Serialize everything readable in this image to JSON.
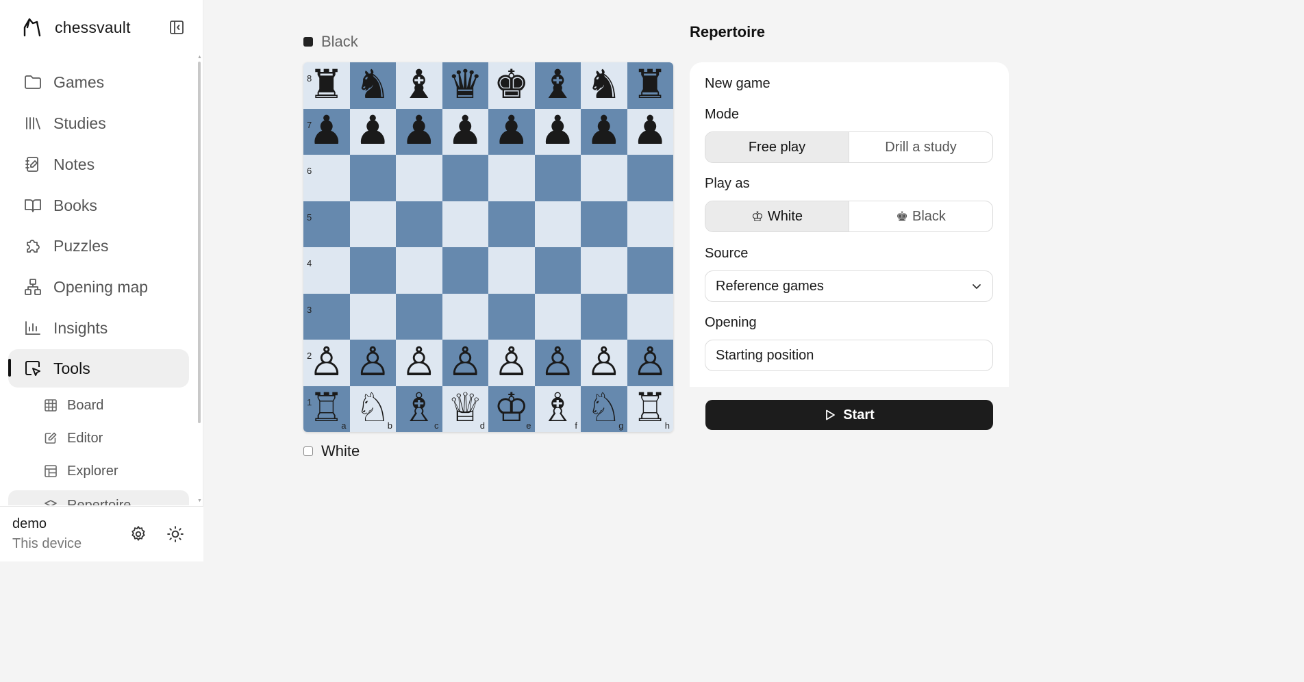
{
  "app": {
    "name": "chessvault"
  },
  "sidebar": {
    "items": [
      {
        "label": "Games",
        "icon": "folder-icon"
      },
      {
        "label": "Studies",
        "icon": "library-icon"
      },
      {
        "label": "Notes",
        "icon": "notebook-icon"
      },
      {
        "label": "Books",
        "icon": "book-icon"
      },
      {
        "label": "Puzzles",
        "icon": "puzzle-icon"
      },
      {
        "label": "Opening map",
        "icon": "network-icon"
      },
      {
        "label": "Insights",
        "icon": "bar-chart-icon"
      },
      {
        "label": "Tools",
        "icon": "pointer-icon",
        "active": true
      }
    ],
    "subitems": [
      {
        "label": "Board",
        "icon": "grid-icon"
      },
      {
        "label": "Editor",
        "icon": "edit-icon"
      },
      {
        "label": "Explorer",
        "icon": "table-icon"
      },
      {
        "label": "Repertoire",
        "icon": "layers-icon",
        "current": true
      }
    ]
  },
  "footer": {
    "user": "demo",
    "device": "This device"
  },
  "board": {
    "top_player": "Black",
    "bottom_player": "White",
    "ranks": [
      "8",
      "7",
      "6",
      "5",
      "4",
      "3",
      "2",
      "1"
    ],
    "files": [
      "a",
      "b",
      "c",
      "d",
      "e",
      "f",
      "g",
      "h"
    ],
    "position": [
      [
        "♜",
        "♞",
        "♝",
        "♛",
        "♚",
        "♝",
        "♞",
        "♜"
      ],
      [
        "♟",
        "♟",
        "♟",
        "♟",
        "♟",
        "♟",
        "♟",
        "♟"
      ],
      [
        "",
        "",
        "",
        "",
        "",
        "",
        "",
        ""
      ],
      [
        "",
        "",
        "",
        "",
        "",
        "",
        "",
        ""
      ],
      [
        "",
        "",
        "",
        "",
        "",
        "",
        "",
        ""
      ],
      [
        "",
        "",
        "",
        "",
        "",
        "",
        "",
        ""
      ],
      [
        "♙",
        "♙",
        "♙",
        "♙",
        "♙",
        "♙",
        "♙",
        "♙"
      ],
      [
        "♖",
        "♘",
        "♗",
        "♕",
        "♔",
        "♗",
        "♘",
        "♖"
      ]
    ],
    "colors": {
      "light": "#dee7f1",
      "dark": "#6689ae"
    }
  },
  "panel": {
    "title": "Repertoire",
    "new_game": "New game",
    "mode": {
      "label": "Mode",
      "options": [
        "Free play",
        "Drill a study"
      ],
      "selected": "Free play"
    },
    "play_as": {
      "label": "Play as",
      "options": [
        "White",
        "Black"
      ],
      "selected": "White",
      "glyphs": [
        "♔",
        "♚"
      ]
    },
    "source": {
      "label": "Source",
      "value": "Reference games"
    },
    "opening": {
      "label": "Opening",
      "value": "Starting position"
    },
    "start_label": "Start"
  }
}
